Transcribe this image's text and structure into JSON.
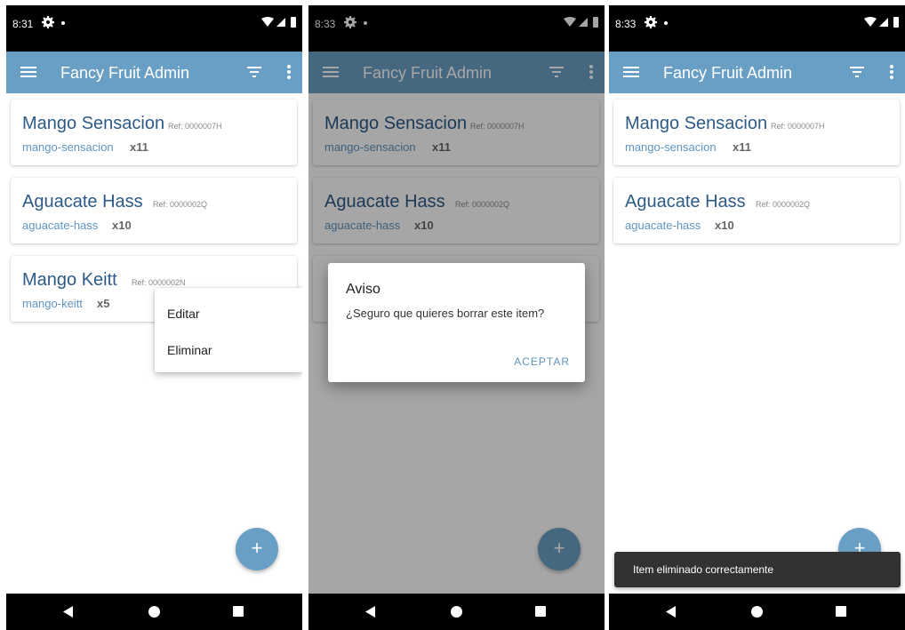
{
  "app": {
    "title": "Fancy Fruit Admin",
    "add_label": "+"
  },
  "colors": {
    "primary": "#6a9fc5",
    "card_title": "#2d5a86",
    "slug": "#5f94bf",
    "snackbar": "#323232"
  },
  "icons": {
    "appbar": [
      "menu-icon",
      "filter-icon",
      "more-vert-icon"
    ],
    "status": [
      "settings-icon",
      "wifi-icon",
      "signal-icon",
      "battery-icon"
    ],
    "nav": [
      "back-icon",
      "home-icon",
      "recents-icon"
    ]
  },
  "screens": [
    {
      "status_time": "8:31",
      "items": [
        {
          "name": "Mango Sensacion",
          "ref": "Ref: 0000007H",
          "slug": "mango-sensacion",
          "qty": "x11"
        },
        {
          "name": "Aguacate Hass",
          "ref": "Ref: 0000002Q",
          "slug": "aguacate-hass",
          "qty": "x10"
        },
        {
          "name": "Mango Keitt",
          "ref": "Ref: 0000002N",
          "slug": "mango-keitt",
          "qty": "x5"
        }
      ],
      "context_menu": {
        "edit": "Editar",
        "delete": "Eliminar"
      }
    },
    {
      "status_time": "8:33",
      "items": [
        {
          "name": "Mango Sensacion",
          "ref": "Ref: 0000007H",
          "slug": "mango-sensacion",
          "qty": "x11"
        },
        {
          "name": "Aguacate Hass",
          "ref": "Ref: 0000002Q",
          "slug": "aguacate-hass",
          "qty": "x10"
        }
      ],
      "dialog": {
        "title": "Aviso",
        "message": "¿Seguro que quieres borrar este item?",
        "confirm": "ACEPTAR"
      }
    },
    {
      "status_time": "8:33",
      "items": [
        {
          "name": "Mango Sensacion",
          "ref": "Ref: 0000007H",
          "slug": "mango-sensacion",
          "qty": "x11"
        },
        {
          "name": "Aguacate Hass",
          "ref": "Ref: 0000002Q",
          "slug": "aguacate-hass",
          "qty": "x10"
        }
      ],
      "snackbar": "Item eliminado correctamente"
    }
  ]
}
